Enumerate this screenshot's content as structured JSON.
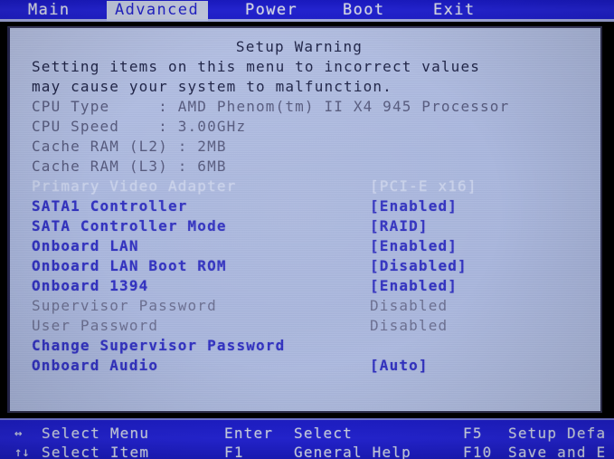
{
  "menu": {
    "tabs": [
      {
        "label": "Main",
        "active": false
      },
      {
        "label": "Advanced",
        "active": true
      },
      {
        "label": "Power",
        "active": false
      },
      {
        "label": "Boot",
        "active": false
      },
      {
        "label": "Exit",
        "active": false
      }
    ]
  },
  "main": {
    "title": "Setup Warning",
    "warning_line1": "Setting items on this menu to incorrect values",
    "warning_line2": "may cause your system to malfunction.",
    "info": [
      {
        "label": "CPU Type     : AMD Phenom(tm) II X4 945 Processor"
      },
      {
        "label": "CPU Speed    : 3.00GHz"
      },
      {
        "label": "Cache RAM (L2) : 2MB"
      },
      {
        "label": "Cache RAM (L3) : 6MB"
      }
    ],
    "settings": [
      {
        "label": "Primary Video Adapter",
        "value": "[PCI-E x16]",
        "state": "ghost"
      },
      {
        "label": "SATA1 Controller",
        "value": "[Enabled]",
        "state": "active"
      },
      {
        "label": "SATA Controller Mode",
        "value": "[RAID]",
        "state": "active"
      },
      {
        "label": "Onboard LAN",
        "value": "[Enabled]",
        "state": "active"
      },
      {
        "label": "Onboard LAN Boot ROM",
        "value": "[Disabled]",
        "state": "active"
      },
      {
        "label": "Onboard 1394",
        "value": "[Enabled]",
        "state": "active"
      },
      {
        "label": "Supervisor Password",
        "value": "Disabled",
        "state": "dim"
      },
      {
        "label": "User Password",
        "value": "Disabled",
        "state": "dim"
      },
      {
        "label": "Change Supervisor Password",
        "value": "",
        "state": "active"
      },
      {
        "label": "Onboard Audio",
        "value": "[Auto]",
        "state": "active"
      }
    ]
  },
  "help": {
    "row1": [
      {
        "key": "↔",
        "action": "Select Menu"
      },
      {
        "key": "Enter",
        "action": "Select"
      },
      {
        "key": "F5",
        "action": "Setup Defa"
      }
    ],
    "row2": [
      {
        "key": "↑↓",
        "action": "Select Item"
      },
      {
        "key": "F1",
        "action": "General Help"
      },
      {
        "key": "F10",
        "action": "Save and E"
      }
    ]
  },
  "colors": {
    "menubar_blue": "#2020cc",
    "panel_bg": "#aebbe0",
    "active_blue": "#2f2fc0",
    "dim_gray": "#6a6e90",
    "ghost": "#c9d2ec",
    "dark_text": "#1d2246"
  }
}
